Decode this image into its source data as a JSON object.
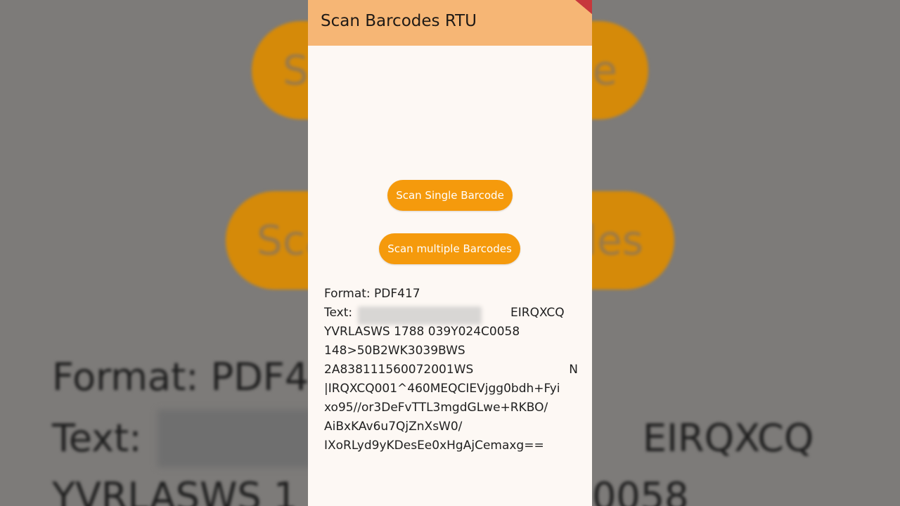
{
  "app": {
    "title": "Scan Barcodes RTU"
  },
  "buttons": {
    "scan_single": "Scan Single Barcode",
    "scan_multiple": "Scan multiple Barcodes"
  },
  "result": {
    "format_line": "Format: PDF417",
    "text_label": "Text:",
    "text_line1_tail": "EIRQXCQ",
    "text_line2": "YVRLASWS 1788 039Y024C0058",
    "text_line3": "148>50B2WK3039BWS",
    "text_line4": "2A838111560072001WS",
    "text_line4_tail": "N",
    "text_line5": "|IRQXCQ001^460MEQCIEVjgg0bdh+Fyi",
    "text_line6": "xo95//or3DeFvTTL3mgdGLwe+RKBO/",
    "text_line7": "AiBxKAv6u7QjZnXsW0/",
    "text_line8": "IXoRLyd9yKDesEe0xHgAjCemaxg=="
  },
  "background": {
    "pill1_left": "Se",
    "pill1_right": "de",
    "pill2_left": "Sca",
    "pill2_right": "des",
    "format_fragment": "Format: PDF4",
    "text_label": "Text:",
    "text_tail": "EIRQXCQ",
    "line2_left": "YVRLASWS 1",
    "line2_right": "0058"
  },
  "colors": {
    "appbar": "#f6b675",
    "button": "#f59a0c",
    "surface": "#fdf8f4"
  }
}
